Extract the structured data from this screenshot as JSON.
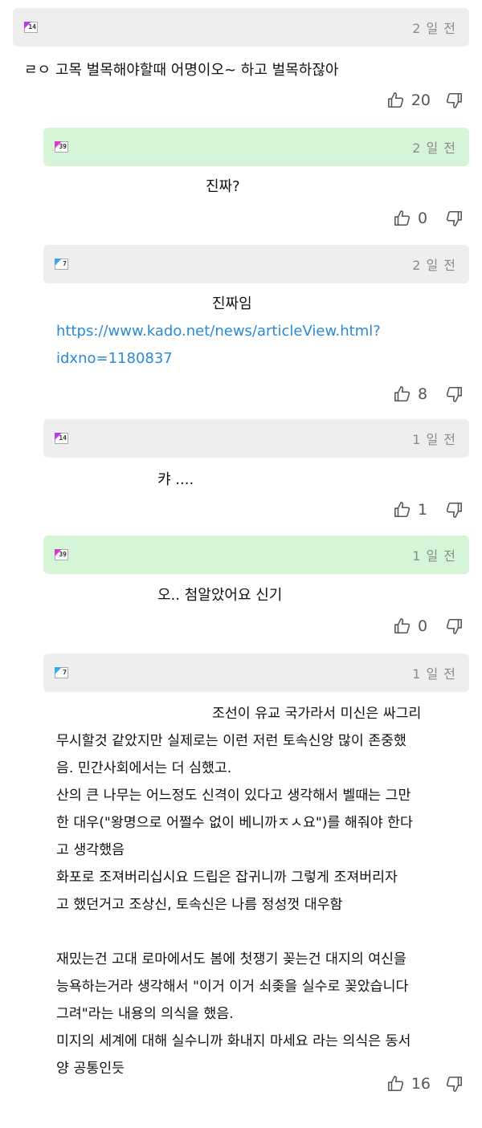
{
  "comments": [
    {
      "level_badge": "14",
      "badge_color": "#c037e8",
      "time": "2 일 전",
      "body": [
        "ㄹㅇ 고목 벌목해야할때 어명이오~ 하고 벌목하잖아"
      ],
      "likes": "20"
    },
    {
      "level_badge": "39",
      "badge_color": "#d63cc7",
      "time": "2 일 전",
      "body": [
        "진짜?"
      ],
      "likes": "0"
    },
    {
      "level_badge": "7",
      "badge_color": "#3aa7e6",
      "time": "2 일 전",
      "body": [
        "진짜임"
      ],
      "link": [
        "https://www.kado.net/news/articleView.html?",
        "idxno=1180837"
      ],
      "likes": "8"
    },
    {
      "level_badge": "14",
      "badge_color": "#c037e8",
      "time": "1 일 전",
      "body": [
        "캬 ...."
      ],
      "likes": "1"
    },
    {
      "level_badge": "39",
      "badge_color": "#d63cc7",
      "time": "1 일 전",
      "body": [
        "오.. 첨알았어요 신기"
      ],
      "likes": "0"
    },
    {
      "level_badge": "7",
      "badge_color": "#3aa7e6",
      "time": "1 일 전",
      "body": [
        "조선이 유교 국가라서 미신은 싸그리",
        "무시할것 같았지만 실제로는 이런 저런 토속신앙 많이 존중했",
        "음. 민간사회에서는 더 심했고.",
        "산의 큰 나무는 어느정도 신격이 있다고 생각해서 벨때는 그만",
        "한 대우(\"왕명으로 어쩔수 없이 베니까ㅈㅅ요\")를 해줘야 한다",
        "고 생각했음",
        "화포로 조져버리십시요 드립은 잡귀니까 그렇게 조져버리자",
        "고 했던거고 조상신, 토속신은 나름 정성껏 대우함",
        "",
        "재밌는건 고대 로마에서도 봄에 첫쟁기 꽂는건 대지의 여신을",
        "능욕하는거라 생각해서 \"이거 이거 쇠좆을 실수로 꽂았습니다",
        "그려\"라는 내용의 의식을 했음.",
        "미지의 세계에 대해 실수니까 화내지 마세요 라는 의식은 동서",
        "양 공통인듯"
      ],
      "likes": "16"
    }
  ]
}
